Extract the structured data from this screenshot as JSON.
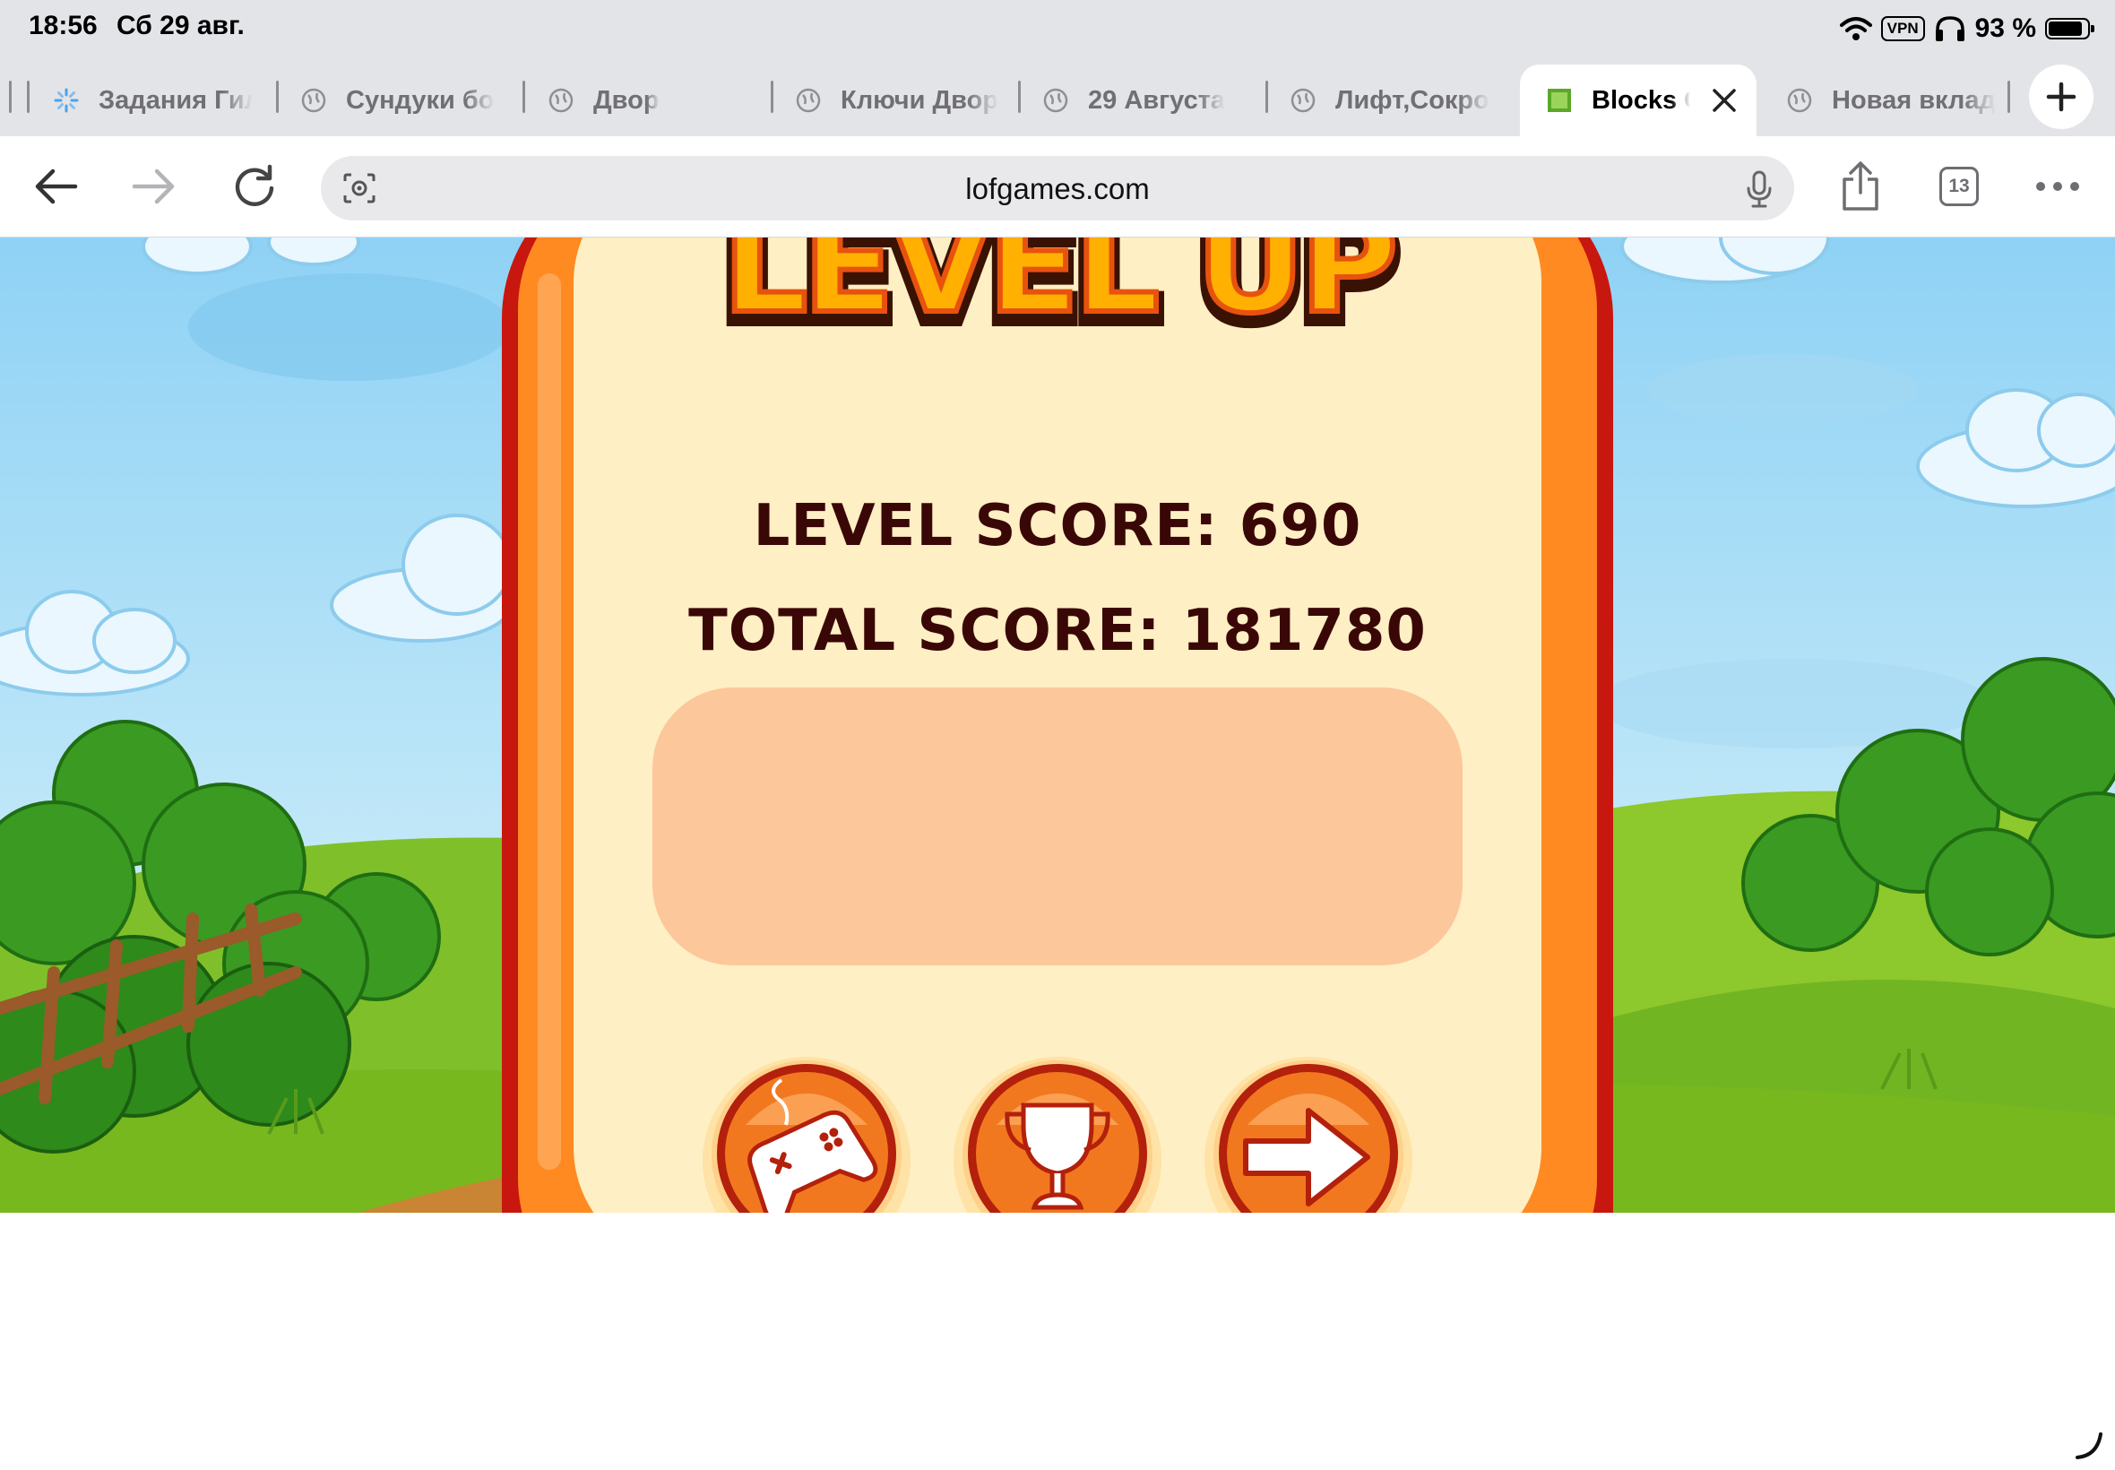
{
  "status_bar": {
    "time": "18:56",
    "date": "Сб 29 авг.",
    "vpn_label": "VPN",
    "battery_percent": "93 %",
    "battery_level": 0.93
  },
  "tabs": [
    {
      "title": "Задания Гил",
      "icon": "loading-spinner-icon",
      "active": false
    },
    {
      "title": "Сундуки бо",
      "icon": "globe-icon",
      "active": false
    },
    {
      "title": "Двор",
      "icon": "globe-icon",
      "active": false
    },
    {
      "title": "Ключи Двор",
      "icon": "globe-icon",
      "active": false
    },
    {
      "title": "29 Августа",
      "icon": "globe-icon",
      "active": false
    },
    {
      "title": "Лифт,Сокро",
      "icon": "globe-icon",
      "active": false
    },
    {
      "title": "Blocks C",
      "icon": "green-square-favicon",
      "active": true
    },
    {
      "title": "Новая вклад",
      "icon": "globe-icon",
      "active": false
    }
  ],
  "toolbar": {
    "url": "lofgames.com",
    "tab_count": "13"
  },
  "game": {
    "heading": "LEVEL UP",
    "level_score": "LEVEL SCORE: 690",
    "total_score": "TOTAL SCORE: 181780",
    "buttons": [
      "gamepad-icon",
      "trophy-icon",
      "arrow-right-icon"
    ],
    "colors": {
      "panel_outer": "#c8170e",
      "panel_orange": "#ff8a22",
      "panel_inner": "#ffefc4",
      "score_box": "#fcc79a",
      "score_text": "#3a0707"
    }
  }
}
